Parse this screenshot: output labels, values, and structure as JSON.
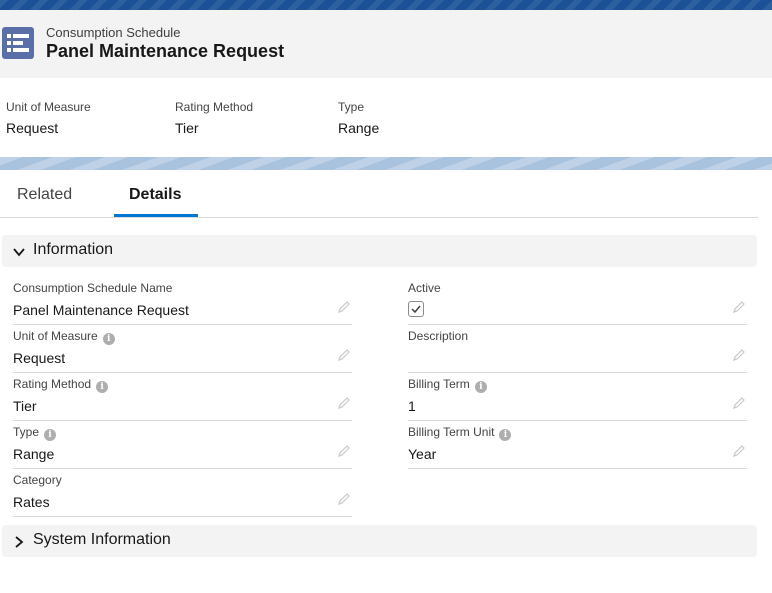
{
  "header": {
    "object_type": "Consumption Schedule",
    "title": "Panel Maintenance Request",
    "icon": "record-list-icon",
    "icon_color": "#5a6fa8"
  },
  "highlights": [
    {
      "label": "Unit of Measure",
      "value": "Request"
    },
    {
      "label": "Rating Method",
      "value": "Tier"
    },
    {
      "label": "Type",
      "value": "Range"
    }
  ],
  "tabs": [
    {
      "label": "Related",
      "active": false
    },
    {
      "label": "Details",
      "active": true
    }
  ],
  "sections": {
    "information": {
      "title": "Information",
      "expanded": true,
      "fields": {
        "consumption_schedule_name": {
          "label": "Consumption Schedule Name",
          "value": "Panel Maintenance Request"
        },
        "unit_of_measure": {
          "label": "Unit of Measure",
          "value": "Request"
        },
        "rating_method": {
          "label": "Rating Method",
          "value": "Tier"
        },
        "type": {
          "label": "Type",
          "value": "Range"
        },
        "category": {
          "label": "Category",
          "value": "Rates"
        },
        "active": {
          "label": "Active",
          "checked": true
        },
        "description": {
          "label": "Description",
          "value": ""
        },
        "billing_term": {
          "label": "Billing Term",
          "value": "1"
        },
        "billing_term_unit": {
          "label": "Billing Term Unit",
          "value": "Year"
        }
      }
    },
    "system_information": {
      "title": "System Information",
      "expanded": false
    }
  },
  "colors": {
    "brand_band": "#1b5297",
    "active_tab": "#0176d3"
  }
}
